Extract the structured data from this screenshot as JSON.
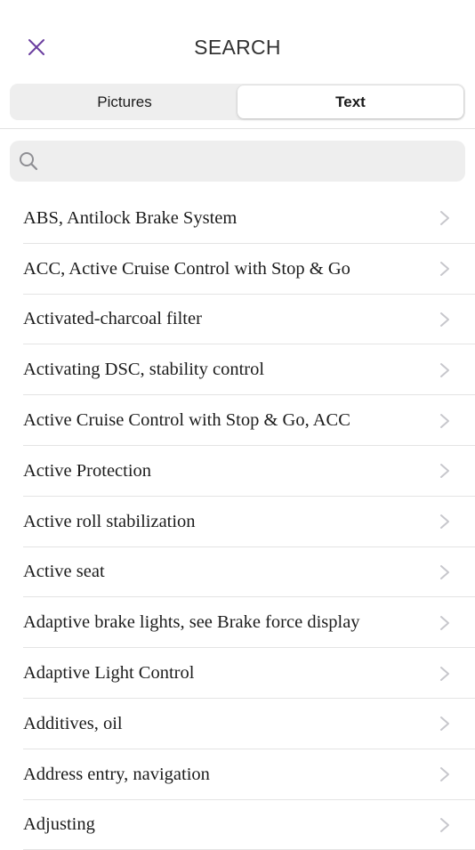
{
  "header": {
    "title": "SEARCH",
    "close_icon": "close-icon",
    "accent_color": "#6b3fa0"
  },
  "tabs": [
    {
      "label": "Pictures",
      "active": false
    },
    {
      "label": "Text",
      "active": true
    }
  ],
  "search": {
    "placeholder": "",
    "value": "",
    "icon": "search-icon"
  },
  "results": [
    {
      "label": "ABS, Antilock Brake System"
    },
    {
      "label": "ACC, Active Cruise Control with Stop & Go"
    },
    {
      "label": "Activated-charcoal filter"
    },
    {
      "label": "Activating DSC, stability control"
    },
    {
      "label": "Active Cruise Control with Stop & Go, ACC"
    },
    {
      "label": "Active Protection"
    },
    {
      "label": "Active roll stabilization"
    },
    {
      "label": "Active seat"
    },
    {
      "label": "Adaptive brake lights, see Brake force display"
    },
    {
      "label": "Adaptive Light Control"
    },
    {
      "label": "Additives, oil"
    },
    {
      "label": "Address entry, navigation"
    },
    {
      "label": "Adjusting"
    }
  ]
}
